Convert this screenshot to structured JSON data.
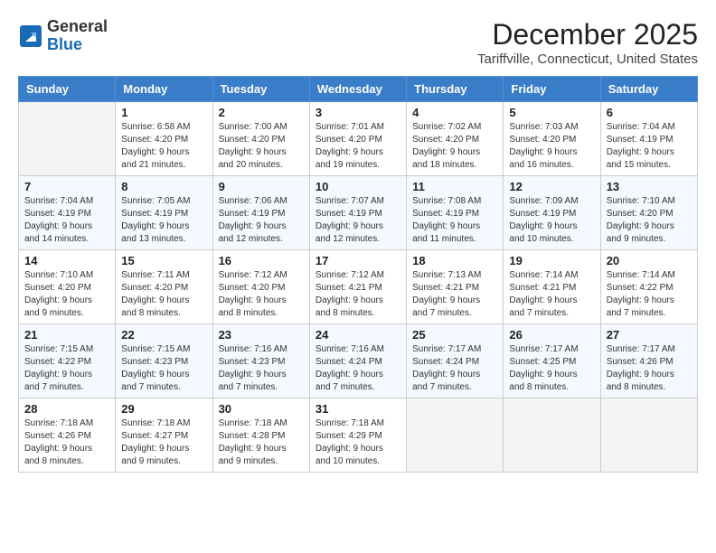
{
  "header": {
    "logo_line1": "General",
    "logo_line2": "Blue",
    "title": "December 2025",
    "subtitle": "Tariffville, Connecticut, United States"
  },
  "calendar": {
    "days_of_week": [
      "Sunday",
      "Monday",
      "Tuesday",
      "Wednesday",
      "Thursday",
      "Friday",
      "Saturday"
    ],
    "weeks": [
      [
        {
          "day": "",
          "info": ""
        },
        {
          "day": "1",
          "info": "Sunrise: 6:58 AM\nSunset: 4:20 PM\nDaylight: 9 hours and 21 minutes."
        },
        {
          "day": "2",
          "info": "Sunrise: 7:00 AM\nSunset: 4:20 PM\nDaylight: 9 hours and 20 minutes."
        },
        {
          "day": "3",
          "info": "Sunrise: 7:01 AM\nSunset: 4:20 PM\nDaylight: 9 hours and 19 minutes."
        },
        {
          "day": "4",
          "info": "Sunrise: 7:02 AM\nSunset: 4:20 PM\nDaylight: 9 hours and 18 minutes."
        },
        {
          "day": "5",
          "info": "Sunrise: 7:03 AM\nSunset: 4:20 PM\nDaylight: 9 hours and 16 minutes."
        },
        {
          "day": "6",
          "info": "Sunrise: 7:04 AM\nSunset: 4:19 PM\nDaylight: 9 hours and 15 minutes."
        }
      ],
      [
        {
          "day": "7",
          "info": "Sunrise: 7:04 AM\nSunset: 4:19 PM\nDaylight: 9 hours and 14 minutes."
        },
        {
          "day": "8",
          "info": "Sunrise: 7:05 AM\nSunset: 4:19 PM\nDaylight: 9 hours and 13 minutes."
        },
        {
          "day": "9",
          "info": "Sunrise: 7:06 AM\nSunset: 4:19 PM\nDaylight: 9 hours and 12 minutes."
        },
        {
          "day": "10",
          "info": "Sunrise: 7:07 AM\nSunset: 4:19 PM\nDaylight: 9 hours and 12 minutes."
        },
        {
          "day": "11",
          "info": "Sunrise: 7:08 AM\nSunset: 4:19 PM\nDaylight: 9 hours and 11 minutes."
        },
        {
          "day": "12",
          "info": "Sunrise: 7:09 AM\nSunset: 4:19 PM\nDaylight: 9 hours and 10 minutes."
        },
        {
          "day": "13",
          "info": "Sunrise: 7:10 AM\nSunset: 4:20 PM\nDaylight: 9 hours and 9 minutes."
        }
      ],
      [
        {
          "day": "14",
          "info": "Sunrise: 7:10 AM\nSunset: 4:20 PM\nDaylight: 9 hours and 9 minutes."
        },
        {
          "day": "15",
          "info": "Sunrise: 7:11 AM\nSunset: 4:20 PM\nDaylight: 9 hours and 8 minutes."
        },
        {
          "day": "16",
          "info": "Sunrise: 7:12 AM\nSunset: 4:20 PM\nDaylight: 9 hours and 8 minutes."
        },
        {
          "day": "17",
          "info": "Sunrise: 7:12 AM\nSunset: 4:21 PM\nDaylight: 9 hours and 8 minutes."
        },
        {
          "day": "18",
          "info": "Sunrise: 7:13 AM\nSunset: 4:21 PM\nDaylight: 9 hours and 7 minutes."
        },
        {
          "day": "19",
          "info": "Sunrise: 7:14 AM\nSunset: 4:21 PM\nDaylight: 9 hours and 7 minutes."
        },
        {
          "day": "20",
          "info": "Sunrise: 7:14 AM\nSunset: 4:22 PM\nDaylight: 9 hours and 7 minutes."
        }
      ],
      [
        {
          "day": "21",
          "info": "Sunrise: 7:15 AM\nSunset: 4:22 PM\nDaylight: 9 hours and 7 minutes."
        },
        {
          "day": "22",
          "info": "Sunrise: 7:15 AM\nSunset: 4:23 PM\nDaylight: 9 hours and 7 minutes."
        },
        {
          "day": "23",
          "info": "Sunrise: 7:16 AM\nSunset: 4:23 PM\nDaylight: 9 hours and 7 minutes."
        },
        {
          "day": "24",
          "info": "Sunrise: 7:16 AM\nSunset: 4:24 PM\nDaylight: 9 hours and 7 minutes."
        },
        {
          "day": "25",
          "info": "Sunrise: 7:17 AM\nSunset: 4:24 PM\nDaylight: 9 hours and 7 minutes."
        },
        {
          "day": "26",
          "info": "Sunrise: 7:17 AM\nSunset: 4:25 PM\nDaylight: 9 hours and 8 minutes."
        },
        {
          "day": "27",
          "info": "Sunrise: 7:17 AM\nSunset: 4:26 PM\nDaylight: 9 hours and 8 minutes."
        }
      ],
      [
        {
          "day": "28",
          "info": "Sunrise: 7:18 AM\nSunset: 4:26 PM\nDaylight: 9 hours and 8 minutes."
        },
        {
          "day": "29",
          "info": "Sunrise: 7:18 AM\nSunset: 4:27 PM\nDaylight: 9 hours and 9 minutes."
        },
        {
          "day": "30",
          "info": "Sunrise: 7:18 AM\nSunset: 4:28 PM\nDaylight: 9 hours and 9 minutes."
        },
        {
          "day": "31",
          "info": "Sunrise: 7:18 AM\nSunset: 4:29 PM\nDaylight: 9 hours and 10 minutes."
        },
        {
          "day": "",
          "info": ""
        },
        {
          "day": "",
          "info": ""
        },
        {
          "day": "",
          "info": ""
        }
      ]
    ]
  }
}
